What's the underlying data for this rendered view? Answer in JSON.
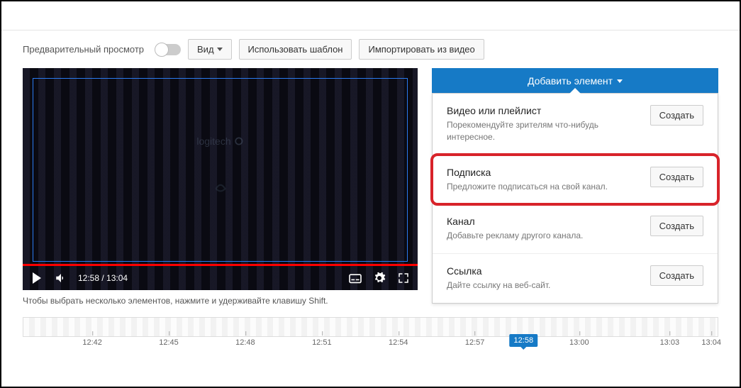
{
  "toolbar": {
    "preview_label": "Предварительный просмотр",
    "view_label": "Вид",
    "template_label": "Использовать шаблон",
    "import_label": "Импортировать из видео"
  },
  "player": {
    "time": "12:58 / 13:04",
    "ghost_logo": "logitech"
  },
  "hint": "Чтобы выбрать несколько элементов, нажмите и удерживайте клавишу Shift.",
  "add_button": "Добавить элемент",
  "options": [
    {
      "title": "Видео или плейлист",
      "desc": "Порекомендуйте зрителям что-нибудь интересное.",
      "btn": "Создать",
      "highlight": false
    },
    {
      "title": "Подписка",
      "desc": "Предложите подписаться на свой канал.",
      "btn": "Создать",
      "highlight": true
    },
    {
      "title": "Канал",
      "desc": "Добавьте рекламу другого канала.",
      "btn": "Создать",
      "highlight": false
    },
    {
      "title": "Ссылка",
      "desc": "Дайте ссылку на веб-сайт.",
      "btn": "Создать",
      "highlight": false
    }
  ],
  "timeline": {
    "ticks": [
      "12:42",
      "12:45",
      "12:48",
      "12:51",
      "12:54",
      "12:57",
      "13:00",
      "13:03",
      "13:04"
    ],
    "playhead": "12:58"
  }
}
